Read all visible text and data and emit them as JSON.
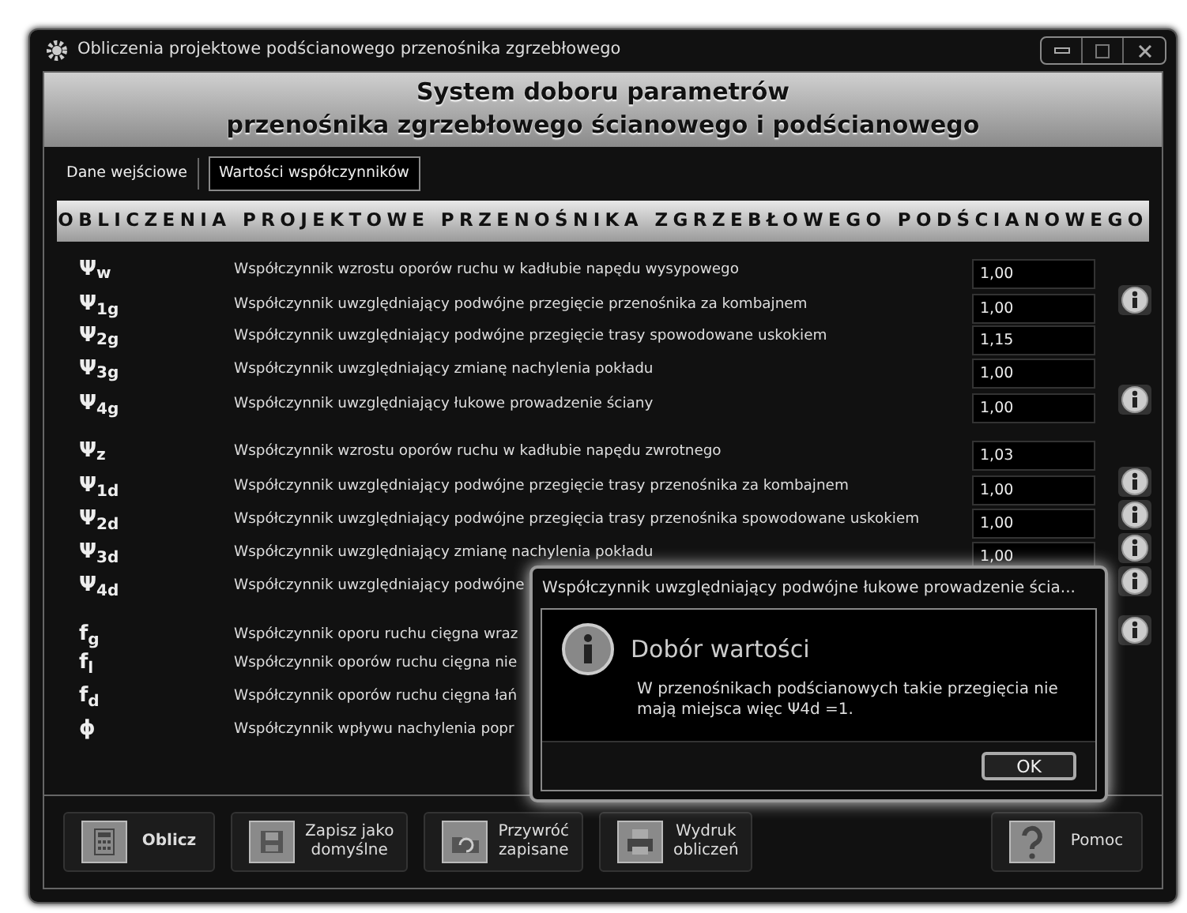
{
  "window": {
    "title": "Obliczenia projektowe podścianowego przenośnika zgrzebłowego"
  },
  "header": [
    "System doboru parametrów",
    "przenośnika zgrzebłowego ścianowego i podścianowego"
  ],
  "tabs": [
    {
      "label": "Dane wejściowe",
      "selected": false
    },
    {
      "label": "Wartości współczynników",
      "selected": true
    }
  ],
  "section_title": "OBLICZENIA PROJEKTOWE PRZENOŚNIKA ZGRZEBŁOWEGO PODŚCIANOWEGO",
  "groups": [
    [
      {
        "symbol": "Ψ$_{w}$",
        "description": "Współczynnik wzrostu oporów ruchu w kadłubie napędu wysypowego",
        "value": "1,00",
        "info": false
      },
      {
        "symbol": "Ψ$_{1g}$",
        "description": "Współczynnik uwzględniający podwójne przegięcie przenośnika za kombajnem",
        "value": "1,00",
        "info": true
      },
      {
        "symbol": "Ψ$_{2g}$",
        "description": "Współczynnik uwzględniający podwójne przegięcie trasy spowodowane uskokiem",
        "value": "1,15",
        "info": false
      },
      {
        "symbol": "Ψ$_{3g}$",
        "description": "Współczynnik uwzględniający zmianę nachylenia pokładu",
        "value": "1,00",
        "info": false
      },
      {
        "symbol": "Ψ$_{4g}$",
        "description": "Współczynnik uwzględniający łukowe prowadzenie ściany",
        "value": "1,00",
        "info": true
      }
    ],
    [
      {
        "symbol": "Ψ$_{z}$",
        "description": "Współczynnik wzrostu oporów ruchu w kadłubie napędu zwrotnego",
        "value": "1,03",
        "info": false
      },
      {
        "symbol": "Ψ$_{1d}$",
        "description": "Współczynnik uwzględniający podwójne przegięcie trasy przenośnika za kombajnem",
        "value": "1,00",
        "info": true
      },
      {
        "symbol": "Ψ$_{2d}$",
        "description": "Współczynnik uwzględniający podwójne przegięcia trasy przenośnika spowodowane uskokiem",
        "value": "1,00",
        "info": true
      },
      {
        "symbol": "Ψ$_{3d}$",
        "description": "Współczynnik uwzględniający zmianę nachylenia pokładu",
        "value": "1,00",
        "info": true
      },
      {
        "symbol": "Ψ$_{4d}$",
        "description": "Współczynnik uwzględniający podwójne",
        "info": true
      }
    ],
    [
      {
        "symbol": "f$_{g}$",
        "description": "Współczynnik oporu ruchu cięgna wraz",
        "info": true
      },
      {
        "symbol": "f$_{l}$",
        "description": "Współczynnik oporów ruchu cięgna nie",
        "info": false
      },
      {
        "symbol": "f$_{d}$",
        "description": "Współczynnik oporów ruchu cięgna łań",
        "info": false
      },
      {
        "symbol": "ϕ",
        "description": "Współczynnik wpływu nachylenia popr",
        "info": false
      }
    ]
  ],
  "dialog": {
    "title": "Współczynnik uwzględniający podwójne łukowe prowadzenie ścia...",
    "heading": "Dobór wartości",
    "message": "W przenośnikach podścianowych takie przegięcia nie mają miejsca więc Ψ4d =1.",
    "button": "OK"
  },
  "buttons": [
    {
      "kind": "calculator",
      "lines": [
        "Oblicz"
      ],
      "default": true
    },
    {
      "kind": "save",
      "lines": [
        "Zapisz jako",
        "domyślne"
      ],
      "default": false
    },
    {
      "kind": "restore",
      "lines": [
        "Przywróć",
        "zapisane"
      ],
      "default": false
    },
    {
      "kind": "print",
      "lines": [
        "Wydruk",
        "obliczeń"
      ],
      "default": false
    },
    {
      "kind": "help",
      "lines": [
        "Pomoc"
      ],
      "default": false
    }
  ]
}
